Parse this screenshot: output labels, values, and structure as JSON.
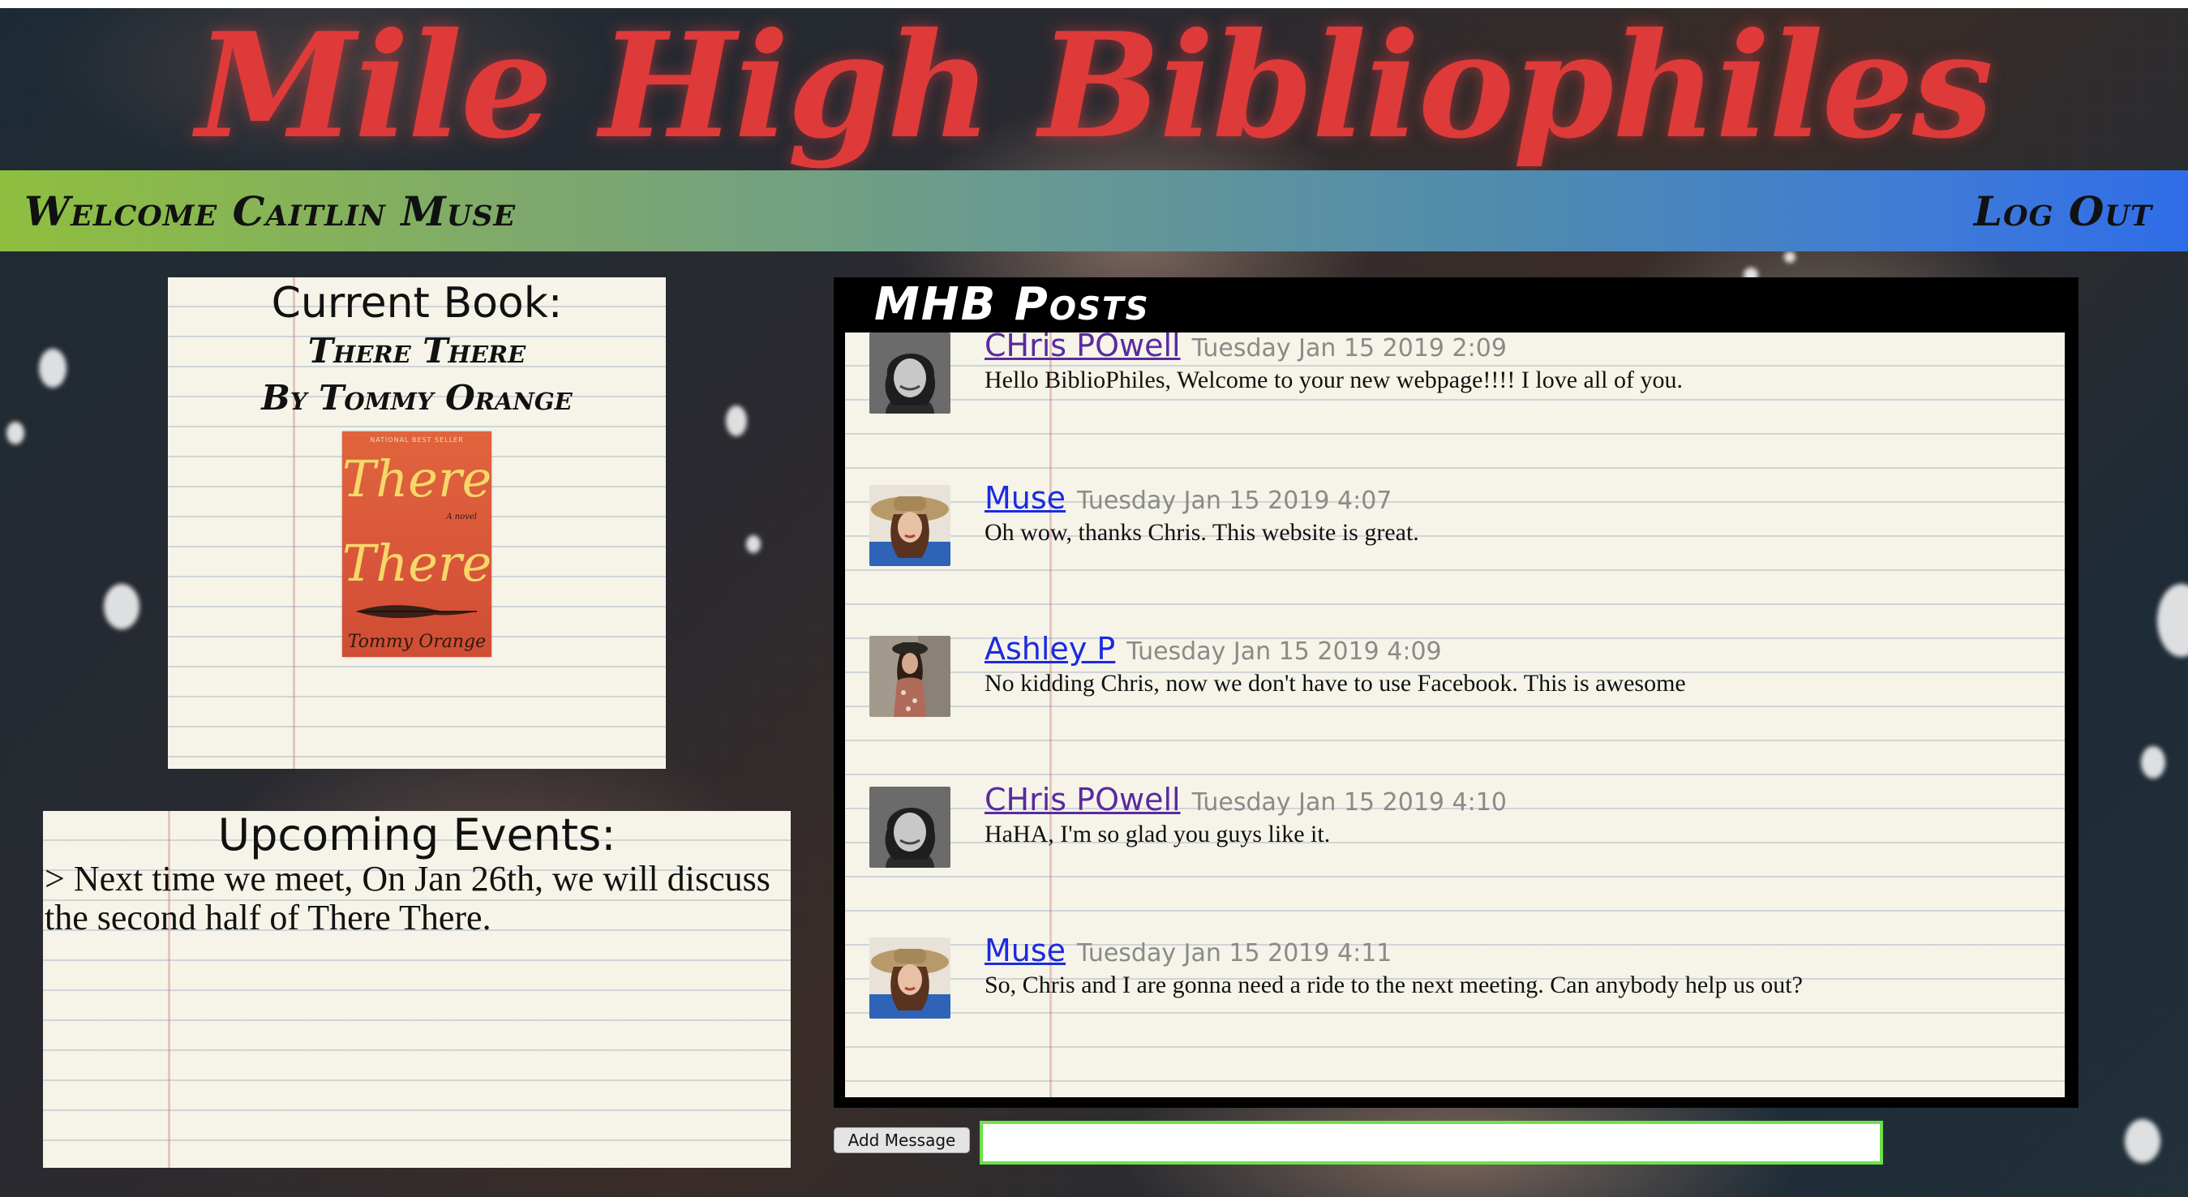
{
  "site": {
    "title": "Mile High Bibliophiles"
  },
  "header": {
    "welcome": "Welcome Caitlin Muse",
    "logout": "Log Out"
  },
  "current_book": {
    "heading": "Current Book:",
    "title": "There There",
    "byline": "By Tommy Orange",
    "cover": {
      "badge": "NATIONAL BEST SELLER",
      "title_line1": "There",
      "title_line2": "There",
      "subtitle": "A novel",
      "author": "Tommy Orange"
    }
  },
  "events": {
    "heading": "Upcoming Events:",
    "items": [
      "> Next time we meet, On Jan 26th, we will discuss the second half of There There."
    ]
  },
  "posts": {
    "title": "MHB Posts",
    "items": [
      {
        "author": "CHris POwell",
        "time": "Tuesday Jan 15 2019 2:09",
        "message": "Hello BiblioPhiles, Welcome to your new webpage!!!! I love all of you.",
        "avatar": "man-avatar"
      },
      {
        "author": "Muse",
        "time": "Tuesday Jan 15 2019 4:07",
        "message": "Oh wow, thanks Chris. This website is great.",
        "avatar": "woman-hat-avatar"
      },
      {
        "author": "Ashley P",
        "time": "Tuesday Jan 15 2019 4:09",
        "message": "No kidding Chris, now we don't have to use Facebook. This is awesome",
        "avatar": "woman-avatar"
      },
      {
        "author": "CHris POwell",
        "time": "Tuesday Jan 15 2019 4:10",
        "message": "HaHA, I'm so glad you guys like it.",
        "avatar": "man-avatar"
      },
      {
        "author": "Muse",
        "time": "Tuesday Jan 15 2019 4:11",
        "message": "So, Chris and I are gonna need a ride to the next meeting. Can anybody help us out?",
        "avatar": "woman-hat-avatar"
      }
    ]
  },
  "composer": {
    "button_label": "Add Message",
    "input_value": ""
  },
  "colors": {
    "title_red": "#de3a3a",
    "bar_start": "#8fbf3f",
    "bar_end": "#2f6de8",
    "visited_link": "#5a2aa0",
    "link_blue": "#1a2be0",
    "input_border": "#6ee04a"
  }
}
